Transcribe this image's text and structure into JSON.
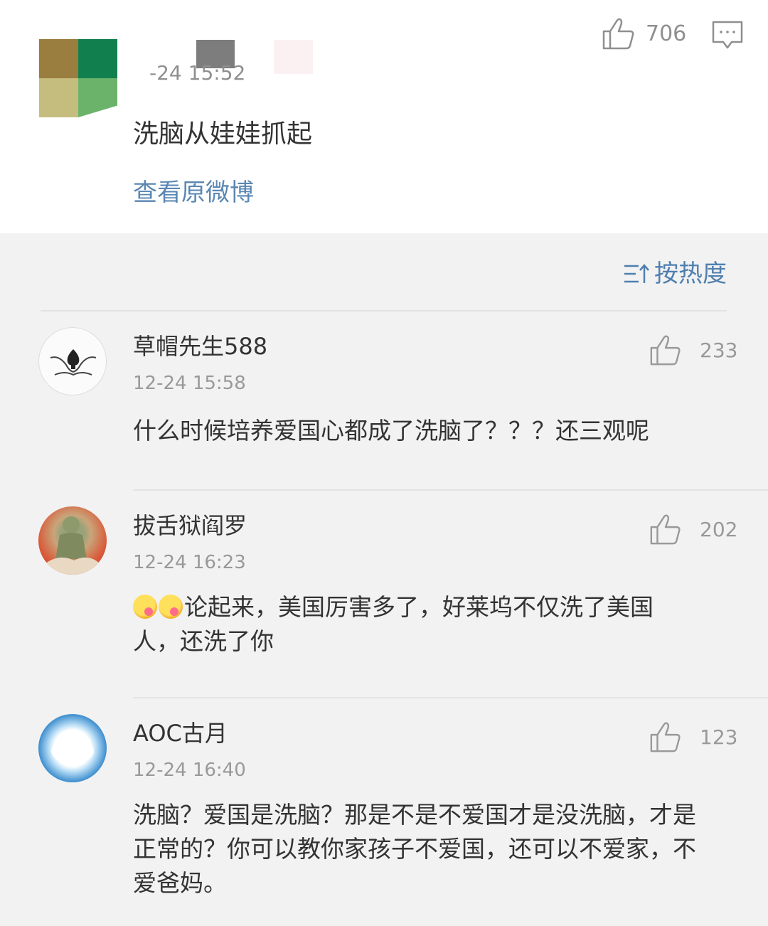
{
  "post": {
    "time": "-24 15:52",
    "text": "洗脑从娃娃抓起",
    "link": "查看原微博",
    "likes": "706"
  },
  "sort": {
    "label": "按热度"
  },
  "comments": [
    {
      "name": "草帽先生588",
      "time": "12-24 15:58",
      "text": "什么时候培养爱国心都成了洗脑了？？？还三观呢",
      "likes": "233"
    },
    {
      "name": "拔舌狱阎罗",
      "time": "12-24 16:23",
      "text_line1": "论起来，美国厉害多了，好莱坞不仅洗了美国",
      "text_line2": "人，还洗了你",
      "likes": "202"
    },
    {
      "name": "AOC古月",
      "time": "12-24 16:40",
      "text_line1": "洗脑？爱国是洗脑？那是不是不爱国才是没洗脑，才是",
      "text_line2": "正常的？你可以教你家孩子不爱国，还可以不爱家，不",
      "text_line3": "爱爸妈。",
      "likes": "123"
    }
  ]
}
